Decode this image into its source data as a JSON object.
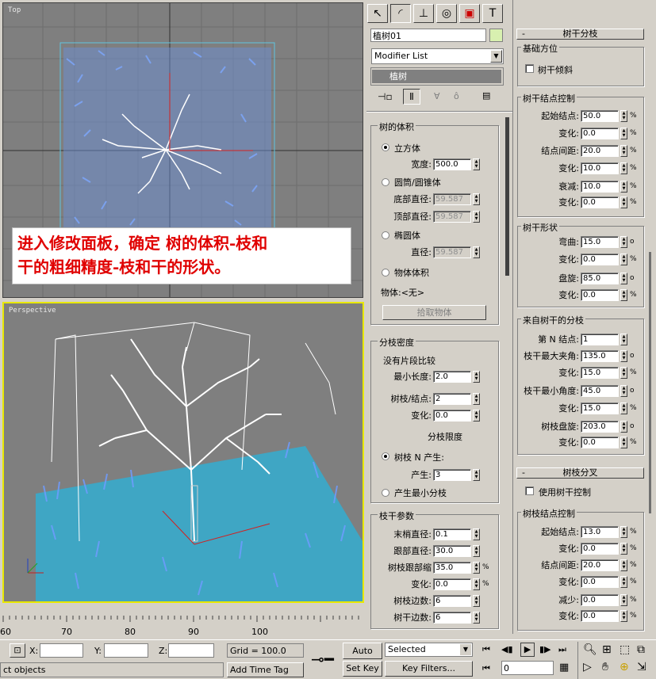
{
  "viewports": {
    "top_label": "Top",
    "persp_label": "Perspective",
    "axis_x": "x",
    "axis_y": "y",
    "axis_z": "z"
  },
  "annotation": {
    "line1": "进入修改面板，确定 树的体积-枝和",
    "line2": "干的粗细精度-枝和干的形状。"
  },
  "panel": {
    "object_name": "植树01",
    "modifier_list": "Modifier List",
    "stack_item": "植树",
    "tree_volume": {
      "title": "树的体积",
      "cube": "立方体",
      "width_label": "宽度:",
      "width_value": "500.0",
      "cylinder": "圆筒/圆锥体",
      "bottom_diam_label": "底部直径:",
      "bottom_diam_value": "59.587",
      "top_diam_label": "顶部直径:",
      "top_diam_value": "59.587",
      "ellipsoid": "椭圆体",
      "diam_label": "直径:",
      "diam_value": "59.587",
      "obj_volume": "物体体积",
      "object_label": "物体:<无>",
      "pick_btn": "拾取物体"
    },
    "branch_density": {
      "title": "分枝密度",
      "no_segment": "没有片段比较",
      "min_len_label": "最小长度:",
      "min_len_value": "2.0",
      "branch_node_label": "树枝/结点:",
      "branch_node_value": "2",
      "change_label": "变化:",
      "change_value": "0.0",
      "limit_title": "分枝限度",
      "nth_gen": "树枝 N 产生:",
      "gen_label": "产生:",
      "gen_value": "3",
      "min_branch": "产生最小分枝"
    },
    "trunk_params": {
      "title": "枝干参数",
      "tip_diam_label": "末梢直径:",
      "tip_diam_value": "0.1",
      "root_diam_label": "跟部直径:",
      "root_diam_value": "30.0",
      "root_shrink_label": "树枝跟部缩",
      "root_shrink_value": "35.0",
      "change_label": "变化:",
      "change_value": "0.0",
      "branch_sides_label": "树枝边数:",
      "branch_sides_value": "6",
      "trunk_sides_label": "树干边数:",
      "trunk_sides_value": "6"
    }
  },
  "right_panel": {
    "trunk_branch_title": "树干分枝",
    "base_dir_title": "基础方位",
    "trunk_tilt": "树干倾斜",
    "node_ctrl_title": "树干结点控制",
    "start_node_label": "起始结点:",
    "start_node_value": "50.0",
    "change1_label": "变化:",
    "change1_value": "0.0",
    "node_spacing_label": "结点间距:",
    "node_spacing_value": "20.0",
    "change2_label": "变化:",
    "change2_value": "10.0",
    "decay_label": "衰减:",
    "decay_value": "10.0",
    "change3_label": "变化:",
    "change3_value": "0.0",
    "shape_title": "树干形状",
    "bend_label": "弯曲:",
    "bend_value": "15.0",
    "change4_label": "变化:",
    "change4_value": "0.0",
    "twist_label": "盘旋:",
    "twist_value": "85.0",
    "change5_label": "变化:",
    "change5_value": "0.0",
    "from_trunk_title": "来自树干的分枝",
    "nth_node_label": "第 N 结点:",
    "nth_node_value": "1",
    "max_angle_label": "枝干最大夹角:",
    "max_angle_value": "135.0",
    "change6_label": "变化:",
    "change6_value": "15.0",
    "min_angle_label": "枝干最小角度:",
    "min_angle_value": "45.0",
    "change7_label": "变化:",
    "change7_value": "15.0",
    "branch_twist_label": "树枝盘旋:",
    "branch_twist_value": "203.0",
    "change8_label": "变化:",
    "change8_value": "0.0",
    "fork_title": "树枝分叉",
    "use_trunk_ctrl": "使用树干控制",
    "branch_node_title": "树枝结点控制",
    "b_start_label": "起始结点:",
    "b_start_value": "13.0",
    "b_change1_label": "变化:",
    "b_change1_value": "0.0",
    "b_spacing_label": "结点间距:",
    "b_spacing_value": "20.0",
    "b_change2_label": "变化:",
    "b_change2_value": "0.0",
    "b_reduce_label": "减少:",
    "b_reduce_value": "0.0",
    "b_change3_label": "变化:",
    "b_change3_value": "0.0",
    "pct": "%",
    "deg": "o"
  },
  "timeline": {
    "ticks": [
      "60",
      "70",
      "80",
      "90",
      "100"
    ]
  },
  "status": {
    "x_label": "X:",
    "y_label": "Y:",
    "z_label": "Z:",
    "grid": "Grid = 100.0",
    "select_msg": "ct objects",
    "add_time_tag": "Add Time Tag",
    "auto_key": "Auto Key",
    "set_key": "Set Key",
    "selected": "Selected",
    "key_filters": "Key Filters...",
    "frame": "0"
  }
}
